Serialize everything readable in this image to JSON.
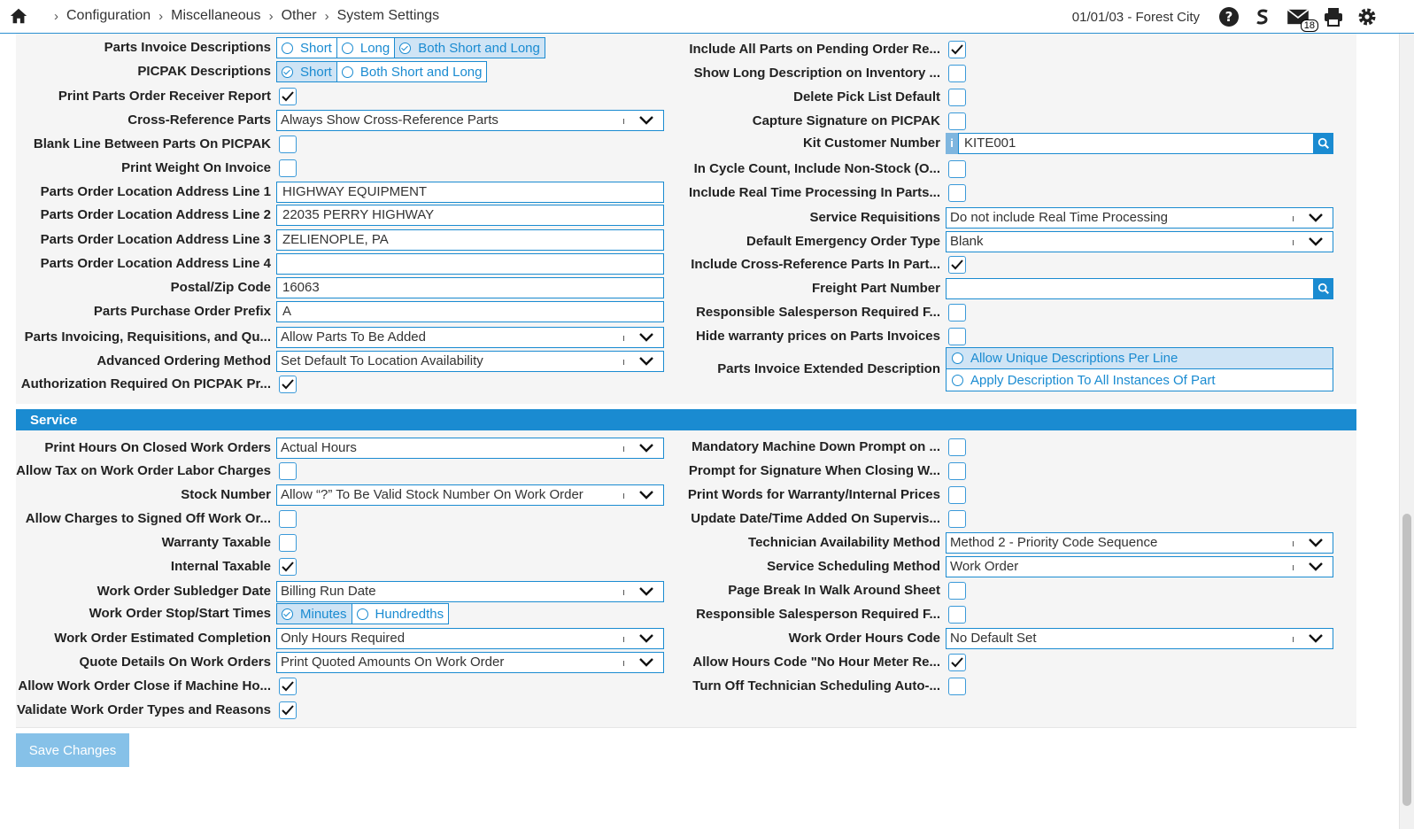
{
  "breadcrumb": [
    "Configuration",
    "Miscellaneous",
    "Other",
    "System Settings"
  ],
  "header": {
    "date_location": "01/01/03 - Forest City",
    "mail_count": "18"
  },
  "parts_left": [
    {
      "label": "Parts Invoice Descriptions",
      "type": "radio",
      "options": [
        "Short",
        "Long",
        "Both Short and Long"
      ],
      "selected": 2
    },
    {
      "label": "PICPAK Descriptions",
      "type": "radio",
      "options": [
        "Short",
        "Both Short and Long"
      ],
      "selected": 0
    },
    {
      "label": "Print Parts Order Receiver Report",
      "type": "check",
      "checked": true
    },
    {
      "label": "Cross-Reference Parts",
      "type": "select",
      "value": "Always Show Cross-Reference Parts"
    },
    {
      "label": "Blank Line Between Parts On PICPAK",
      "type": "check",
      "checked": false
    },
    {
      "label": "Print Weight On Invoice",
      "type": "check",
      "checked": false
    },
    {
      "label": "Parts Order Location Address Line 1",
      "type": "text",
      "value": "HIGHWAY EQUIPMENT"
    },
    {
      "label": "Parts Order Location Address Line 2",
      "type": "text",
      "value": "22035 PERRY HIGHWAY"
    },
    {
      "label": "Parts Order Location Address Line 3",
      "type": "text",
      "value": "ZELIENOPLE, PA"
    },
    {
      "label": "Parts Order Location Address Line 4",
      "type": "text",
      "value": ""
    },
    {
      "label": "Postal/Zip Code",
      "type": "text",
      "value": "16063"
    },
    {
      "label": "Parts Purchase Order Prefix",
      "type": "text",
      "value": "A"
    },
    {
      "label": "Parts Invoicing, Requisitions, and Qu...",
      "type": "select",
      "value": "Allow Parts To Be Added"
    },
    {
      "label": "Advanced Ordering Method",
      "type": "select",
      "value": "Set Default To Location Availability"
    },
    {
      "label": "Authorization Required On PICPAK Pr...",
      "type": "check",
      "checked": true
    }
  ],
  "parts_right": [
    {
      "label": "Include All Parts on Pending Order Re...",
      "type": "check",
      "checked": true
    },
    {
      "label": "Show Long Description on Inventory ...",
      "type": "check",
      "checked": false
    },
    {
      "label": "Delete Pick List Default",
      "type": "check",
      "checked": false
    },
    {
      "label": "Capture Signature on PICPAK",
      "type": "check",
      "checked": false
    },
    {
      "label": "Kit Customer Number",
      "type": "lookup",
      "value": "KITE001",
      "info": "i"
    },
    {
      "label": "In Cycle Count, Include Non-Stock (O...",
      "type": "check",
      "checked": false
    },
    {
      "label": "Include Real Time Processing In Parts...",
      "type": "check",
      "checked": false
    },
    {
      "label": "Service Requisitions",
      "type": "select",
      "value": "Do not include Real Time Processing"
    },
    {
      "label": "Default Emergency Order Type",
      "type": "select",
      "value": "Blank"
    },
    {
      "label": "Include Cross-Reference Parts In Part...",
      "type": "check",
      "checked": true
    },
    {
      "label": "Freight Part Number",
      "type": "lookup",
      "value": ""
    },
    {
      "label": "Responsible Salesperson Required F...",
      "type": "check",
      "checked": false
    },
    {
      "label": "Hide warranty prices on Parts Invoices",
      "type": "check",
      "checked": false
    },
    {
      "label": "Parts Invoice Extended Description",
      "type": "vradio",
      "options": [
        "Allow Unique Descriptions Per Line",
        "Apply Description To All Instances Of Part"
      ],
      "selected": 0
    }
  ],
  "service": {
    "title": "Service",
    "left": [
      {
        "label": "Print Hours On Closed Work Orders",
        "type": "select",
        "value": "Actual Hours"
      },
      {
        "label": "Allow Tax on Work Order Labor Charges",
        "type": "check",
        "checked": false
      },
      {
        "label": "Stock Number",
        "type": "select",
        "value": "Allow “?” To Be Valid Stock Number On Work Order"
      },
      {
        "label": "Allow Charges to Signed Off Work Or...",
        "type": "check",
        "checked": false
      },
      {
        "label": "Warranty Taxable",
        "type": "check",
        "checked": false
      },
      {
        "label": "Internal Taxable",
        "type": "check",
        "checked": true
      },
      {
        "label": "Work Order Subledger Date",
        "type": "select",
        "value": "Billing Run Date"
      },
      {
        "label": "Work Order Stop/Start Times",
        "type": "radio",
        "options": [
          "Minutes",
          "Hundredths"
        ],
        "selected": 0
      },
      {
        "label": "Work Order Estimated Completion",
        "type": "select",
        "value": "Only Hours Required"
      },
      {
        "label": "Quote Details On Work Orders",
        "type": "select",
        "value": "Print Quoted Amounts On Work Order"
      },
      {
        "label": "Allow Work Order Close if Machine Ho...",
        "type": "check",
        "checked": true
      },
      {
        "label": "Validate Work Order Types and Reasons",
        "type": "check",
        "checked": true
      }
    ],
    "right": [
      {
        "label": "Mandatory Machine Down Prompt on ...",
        "type": "check",
        "checked": false
      },
      {
        "label": "Prompt for Signature When Closing W...",
        "type": "check",
        "checked": false
      },
      {
        "label": "Print Words for Warranty/Internal Prices",
        "type": "check",
        "checked": false
      },
      {
        "label": "Update Date/Time Added On Supervis...",
        "type": "check",
        "checked": false
      },
      {
        "label": "Technician Availability Method",
        "type": "select",
        "value": "Method 2 - Priority Code Sequence"
      },
      {
        "label": "Service Scheduling Method",
        "type": "select",
        "value": "Work Order"
      },
      {
        "label": "Page Break In Walk Around Sheet",
        "type": "check",
        "checked": false
      },
      {
        "label": "Responsible Salesperson Required F...",
        "type": "check",
        "checked": false
      },
      {
        "label": "Work Order Hours Code",
        "type": "select",
        "value": "No Default Set"
      },
      {
        "label": "Allow Hours Code \"No Hour Meter Re...",
        "type": "check",
        "checked": true
      },
      {
        "label": "Turn Off Technician Scheduling Auto-...",
        "type": "check",
        "checked": false
      }
    ]
  },
  "actions": {
    "save_label": "Save Changes"
  },
  "colors": {
    "accent": "#1a8bd1",
    "panel": "#f5f5f5",
    "save": "#86c1e8"
  }
}
